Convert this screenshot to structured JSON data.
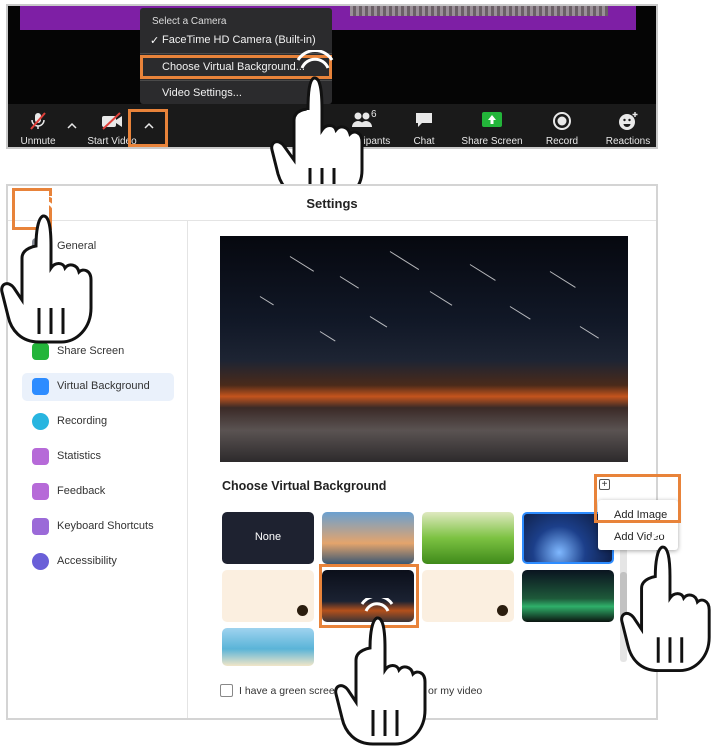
{
  "camera_menu": {
    "header": "Select a Camera",
    "camera_item": "FaceTime HD Camera (Built-in)",
    "virtual_background_item": "Choose Virtual Background...",
    "video_settings_item": "Video Settings..."
  },
  "toolbar": {
    "unmute": "Unmute",
    "start_video": "Start Video",
    "participants_count": "6",
    "participants": "Participants",
    "chat": "Chat",
    "share_screen": "Share Screen",
    "record": "Record",
    "reactions": "Reactions"
  },
  "settings": {
    "title": "Settings",
    "nav": {
      "general": "General",
      "share_screen": "Share Screen",
      "virtual_background": "Virtual Background",
      "recording": "Recording",
      "statistics": "Statistics",
      "feedback": "Feedback",
      "keyboard_shortcuts": "Keyboard Shortcuts",
      "accessibility": "Accessibility"
    },
    "choose_title": "Choose Virtual Background",
    "none_label": "None",
    "add_menu": {
      "add_image": "Add Image",
      "add_video": "Add Video"
    },
    "green_screen_label": "I have a green screen",
    "mirror_label": "or my video"
  },
  "colors": {
    "highlight": "#e8833a",
    "accent_purple": "#7e1fa5",
    "share_green": "#23b53a"
  }
}
